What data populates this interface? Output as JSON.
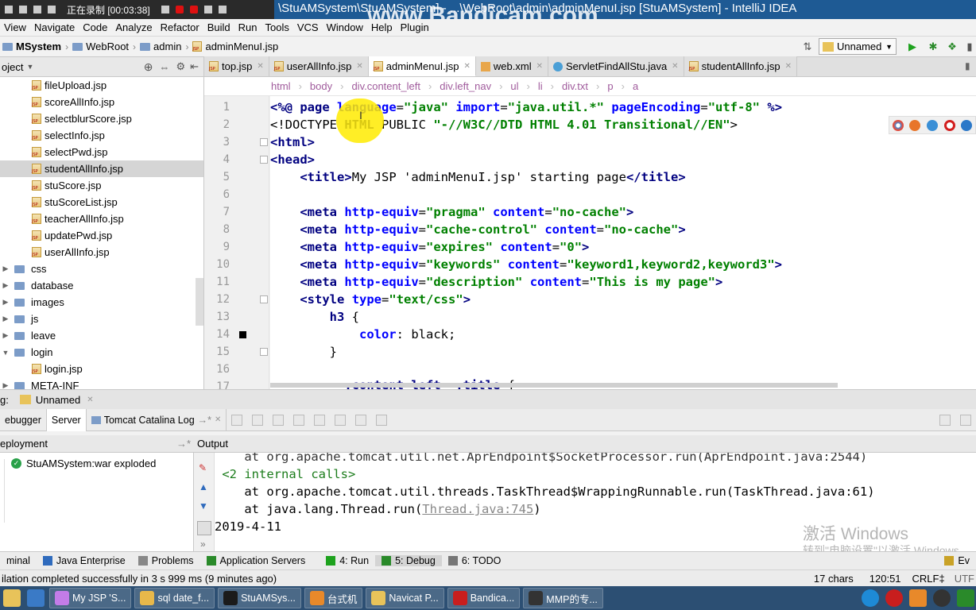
{
  "titlebar": {
    "recording_label": "正在录制 [00:03:38]",
    "window_title": "\\StuAMSystem\\StuAMSystem] - ...\\WebRoot\\admin\\adminMenuI.jsp [StuAMSystem] - IntelliJ IDEA",
    "watermark": "www.Bandicam.com"
  },
  "menu": [
    "View",
    "Navigate",
    "Code",
    "Analyze",
    "Refactor",
    "Build",
    "Run",
    "Tools",
    "VCS",
    "Window",
    "Help",
    "Plugin"
  ],
  "nav": {
    "crumbs": [
      "MSystem",
      "WebRoot",
      "admin",
      "adminMenuI.jsp"
    ],
    "run_config": "Unnamed"
  },
  "project": {
    "header": "oject",
    "items": [
      {
        "label": "fileUpload.jsp",
        "type": "jsp"
      },
      {
        "label": "scoreAllInfo.jsp",
        "type": "jsp"
      },
      {
        "label": "selectblurScore.jsp",
        "type": "jsp"
      },
      {
        "label": "selectInfo.jsp",
        "type": "jsp"
      },
      {
        "label": "selectPwd.jsp",
        "type": "jsp"
      },
      {
        "label": "studentAllInfo.jsp",
        "type": "jsp",
        "selected": true
      },
      {
        "label": "stuScore.jsp",
        "type": "jsp"
      },
      {
        "label": "stuScoreList.jsp",
        "type": "jsp"
      },
      {
        "label": "teacherAllInfo.jsp",
        "type": "jsp"
      },
      {
        "label": "updatePwd.jsp",
        "type": "jsp"
      },
      {
        "label": "userAllInfo.jsp",
        "type": "jsp"
      },
      {
        "label": "css",
        "type": "folder"
      },
      {
        "label": "database",
        "type": "folder"
      },
      {
        "label": "images",
        "type": "folder"
      },
      {
        "label": "js",
        "type": "folder"
      },
      {
        "label": "leave",
        "type": "folder"
      },
      {
        "label": "login",
        "type": "folder",
        "open": true
      },
      {
        "label": "login.jsp",
        "type": "jsp"
      },
      {
        "label": "META-INF",
        "type": "folder"
      }
    ]
  },
  "tabs": [
    {
      "label": "top.jsp",
      "type": "jsp"
    },
    {
      "label": "userAllInfo.jsp",
      "type": "jsp"
    },
    {
      "label": "adminMenuI.jsp",
      "type": "jsp",
      "active": true
    },
    {
      "label": "web.xml",
      "type": "xml"
    },
    {
      "label": "ServletFindAllStu.java",
      "type": "java"
    },
    {
      "label": "studentAllInfo.jsp",
      "type": "jsp"
    }
  ],
  "editor_breadcrumb": [
    "html",
    "body",
    "div.content_left",
    "div.left_nav",
    "ul",
    "li",
    "div.txt",
    "p",
    "a"
  ],
  "code": {
    "line_numbers": [
      "1",
      "2",
      "3",
      "4",
      "5",
      "6",
      "7",
      "8",
      "9",
      "10",
      "11",
      "12",
      "13",
      "14",
      "15",
      "16",
      "17"
    ],
    "lines": [
      [
        [
          "k",
          "<%@ page "
        ],
        [
          "a",
          "language"
        ],
        [
          "p",
          "="
        ],
        [
          "s",
          "\"java\""
        ],
        [
          "p",
          " "
        ],
        [
          "a",
          "import"
        ],
        [
          "p",
          "="
        ],
        [
          "s",
          "\"java.util.*\""
        ],
        [
          "p",
          " "
        ],
        [
          "a",
          "pageEncoding"
        ],
        [
          "p",
          "="
        ],
        [
          "s",
          "\"utf-8\""
        ],
        [
          "p",
          " "
        ],
        [
          "k",
          "%>"
        ]
      ],
      [
        [
          "p",
          "<!DOCTYPE "
        ],
        [
          "k",
          "HTML"
        ],
        [
          "p",
          " PUBLIC "
        ],
        [
          "s",
          "\"-//W3C//DTD HTML 4.01 Transitional//EN\""
        ],
        [
          "p",
          ">"
        ]
      ],
      [
        [
          "t",
          "<"
        ],
        [
          "k",
          "html"
        ],
        [
          "t",
          ">"
        ]
      ],
      [
        [
          "t",
          "<"
        ],
        [
          "k",
          "head"
        ],
        [
          "t",
          ">"
        ]
      ],
      [
        [
          "p",
          "    "
        ],
        [
          "t",
          "<"
        ],
        [
          "k",
          "title"
        ],
        [
          "t",
          ">"
        ],
        [
          "p",
          "My JSP 'adminMenuI.jsp' starting page"
        ],
        [
          "t",
          "</"
        ],
        [
          "k",
          "title"
        ],
        [
          "t",
          ">"
        ]
      ],
      [
        [
          "p",
          ""
        ]
      ],
      [
        [
          "p",
          "    "
        ],
        [
          "t",
          "<"
        ],
        [
          "k",
          "meta"
        ],
        [
          "p",
          " "
        ],
        [
          "a",
          "http-equiv"
        ],
        [
          "p",
          "="
        ],
        [
          "s",
          "\"pragma\""
        ],
        [
          "p",
          " "
        ],
        [
          "a",
          "content"
        ],
        [
          "p",
          "="
        ],
        [
          "s",
          "\"no-cache\""
        ],
        [
          "t",
          ">"
        ]
      ],
      [
        [
          "p",
          "    "
        ],
        [
          "t",
          "<"
        ],
        [
          "k",
          "meta"
        ],
        [
          "p",
          " "
        ],
        [
          "a",
          "http-equiv"
        ],
        [
          "p",
          "="
        ],
        [
          "s",
          "\"cache-control\""
        ],
        [
          "p",
          " "
        ],
        [
          "a",
          "content"
        ],
        [
          "p",
          "="
        ],
        [
          "s",
          "\"no-cache\""
        ],
        [
          "t",
          ">"
        ]
      ],
      [
        [
          "p",
          "    "
        ],
        [
          "t",
          "<"
        ],
        [
          "k",
          "meta"
        ],
        [
          "p",
          " "
        ],
        [
          "a",
          "http-equiv"
        ],
        [
          "p",
          "="
        ],
        [
          "s",
          "\"expires\""
        ],
        [
          "p",
          " "
        ],
        [
          "a",
          "content"
        ],
        [
          "p",
          "="
        ],
        [
          "s",
          "\"0\""
        ],
        [
          "t",
          ">"
        ]
      ],
      [
        [
          "p",
          "    "
        ],
        [
          "t",
          "<"
        ],
        [
          "k",
          "meta"
        ],
        [
          "p",
          " "
        ],
        [
          "a",
          "http-equiv"
        ],
        [
          "p",
          "="
        ],
        [
          "s",
          "\"keywords\""
        ],
        [
          "p",
          " "
        ],
        [
          "a",
          "content"
        ],
        [
          "p",
          "="
        ],
        [
          "s",
          "\"keyword1,keyword2,keyword3\""
        ],
        [
          "t",
          ">"
        ]
      ],
      [
        [
          "p",
          "    "
        ],
        [
          "t",
          "<"
        ],
        [
          "k",
          "meta"
        ],
        [
          "p",
          " "
        ],
        [
          "a",
          "http-equiv"
        ],
        [
          "p",
          "="
        ],
        [
          "s",
          "\"description\""
        ],
        [
          "p",
          " "
        ],
        [
          "a",
          "content"
        ],
        [
          "p",
          "="
        ],
        [
          "s",
          "\"This is my page\""
        ],
        [
          "t",
          ">"
        ]
      ],
      [
        [
          "p",
          "    "
        ],
        [
          "t",
          "<"
        ],
        [
          "k",
          "style"
        ],
        [
          "p",
          " "
        ],
        [
          "a",
          "type"
        ],
        [
          "p",
          "="
        ],
        [
          "s",
          "\"text/css\""
        ],
        [
          "t",
          ">"
        ]
      ],
      [
        [
          "p",
          "        "
        ],
        [
          "k",
          "h3"
        ],
        [
          "p",
          " {"
        ]
      ],
      [
        [
          "p",
          "            "
        ],
        [
          "a",
          "color"
        ],
        [
          "p",
          ": "
        ],
        [
          "p",
          "black;"
        ]
      ],
      [
        [
          "p",
          "        }"
        ]
      ],
      [
        [
          "p",
          ""
        ]
      ],
      [
        [
          "p",
          "          "
        ],
        [
          "k",
          ".content_left  .title"
        ],
        [
          "p",
          " {"
        ]
      ]
    ]
  },
  "run_panel": {
    "label": "Unnamed",
    "prefix": "g:"
  },
  "server_tabs": [
    "ebugger",
    "Server",
    "Tomcat Catalina Log"
  ],
  "deployment": {
    "header": "eployment",
    "item": "StuAMSystem:war exploded"
  },
  "output": {
    "header": "Output",
    "lines": [
      {
        "text": "    at org.apache.tomcat.util.net.AprEndpoint$SocketProcessor.run(AprEndpoint.java:2544)"
      },
      {
        "text": " <2 internal calls>",
        "pre": "",
        "style": "internal"
      },
      {
        "text": "    at org.apache.tomcat.util.threads.TaskThread$WrappingRunnable.run(TaskThread.java:61)"
      },
      {
        "text": "    at java.lang.Thread.run(",
        "link": "Thread.java:745",
        "post": ")"
      },
      {
        "text": "2019-4-11"
      }
    ]
  },
  "activate": {
    "line1": "激活 Windows",
    "line2": "转到\"电脑设置\"以激活 Windows。"
  },
  "toolwindows": [
    "minal",
    "Java Enterprise",
    "Problems",
    "Application Servers",
    "4: Run",
    "5: Debug",
    "6: TODO",
    "Ev"
  ],
  "status": {
    "message": "ilation completed successfully in 3 s 999 ms (9 minutes ago)",
    "chars": "17 chars",
    "position": "120:51",
    "line_sep": "CRLF‡",
    "enc": "UTF"
  },
  "taskbar": [
    {
      "label": "My JSP 'S...",
      "color": "#c37ce8"
    },
    {
      "label": "sql date_f...",
      "color": "#e8b84a"
    },
    {
      "label": "StuAMSys...",
      "color": "#1b1b1b"
    },
    {
      "label": "台式机",
      "color": "#e8892a"
    },
    {
      "label": "Navicat P...",
      "color": "#e8c35a"
    },
    {
      "label": "Bandica...",
      "color": "#c81e1e"
    },
    {
      "label": "MMP的专...",
      "color": "#333"
    }
  ],
  "colors": {
    "keyword": "#000080",
    "attribute": "#0000ff",
    "string": "#008000",
    "title_bar": "#1e5a94",
    "taskbar": "#2c4f73"
  }
}
